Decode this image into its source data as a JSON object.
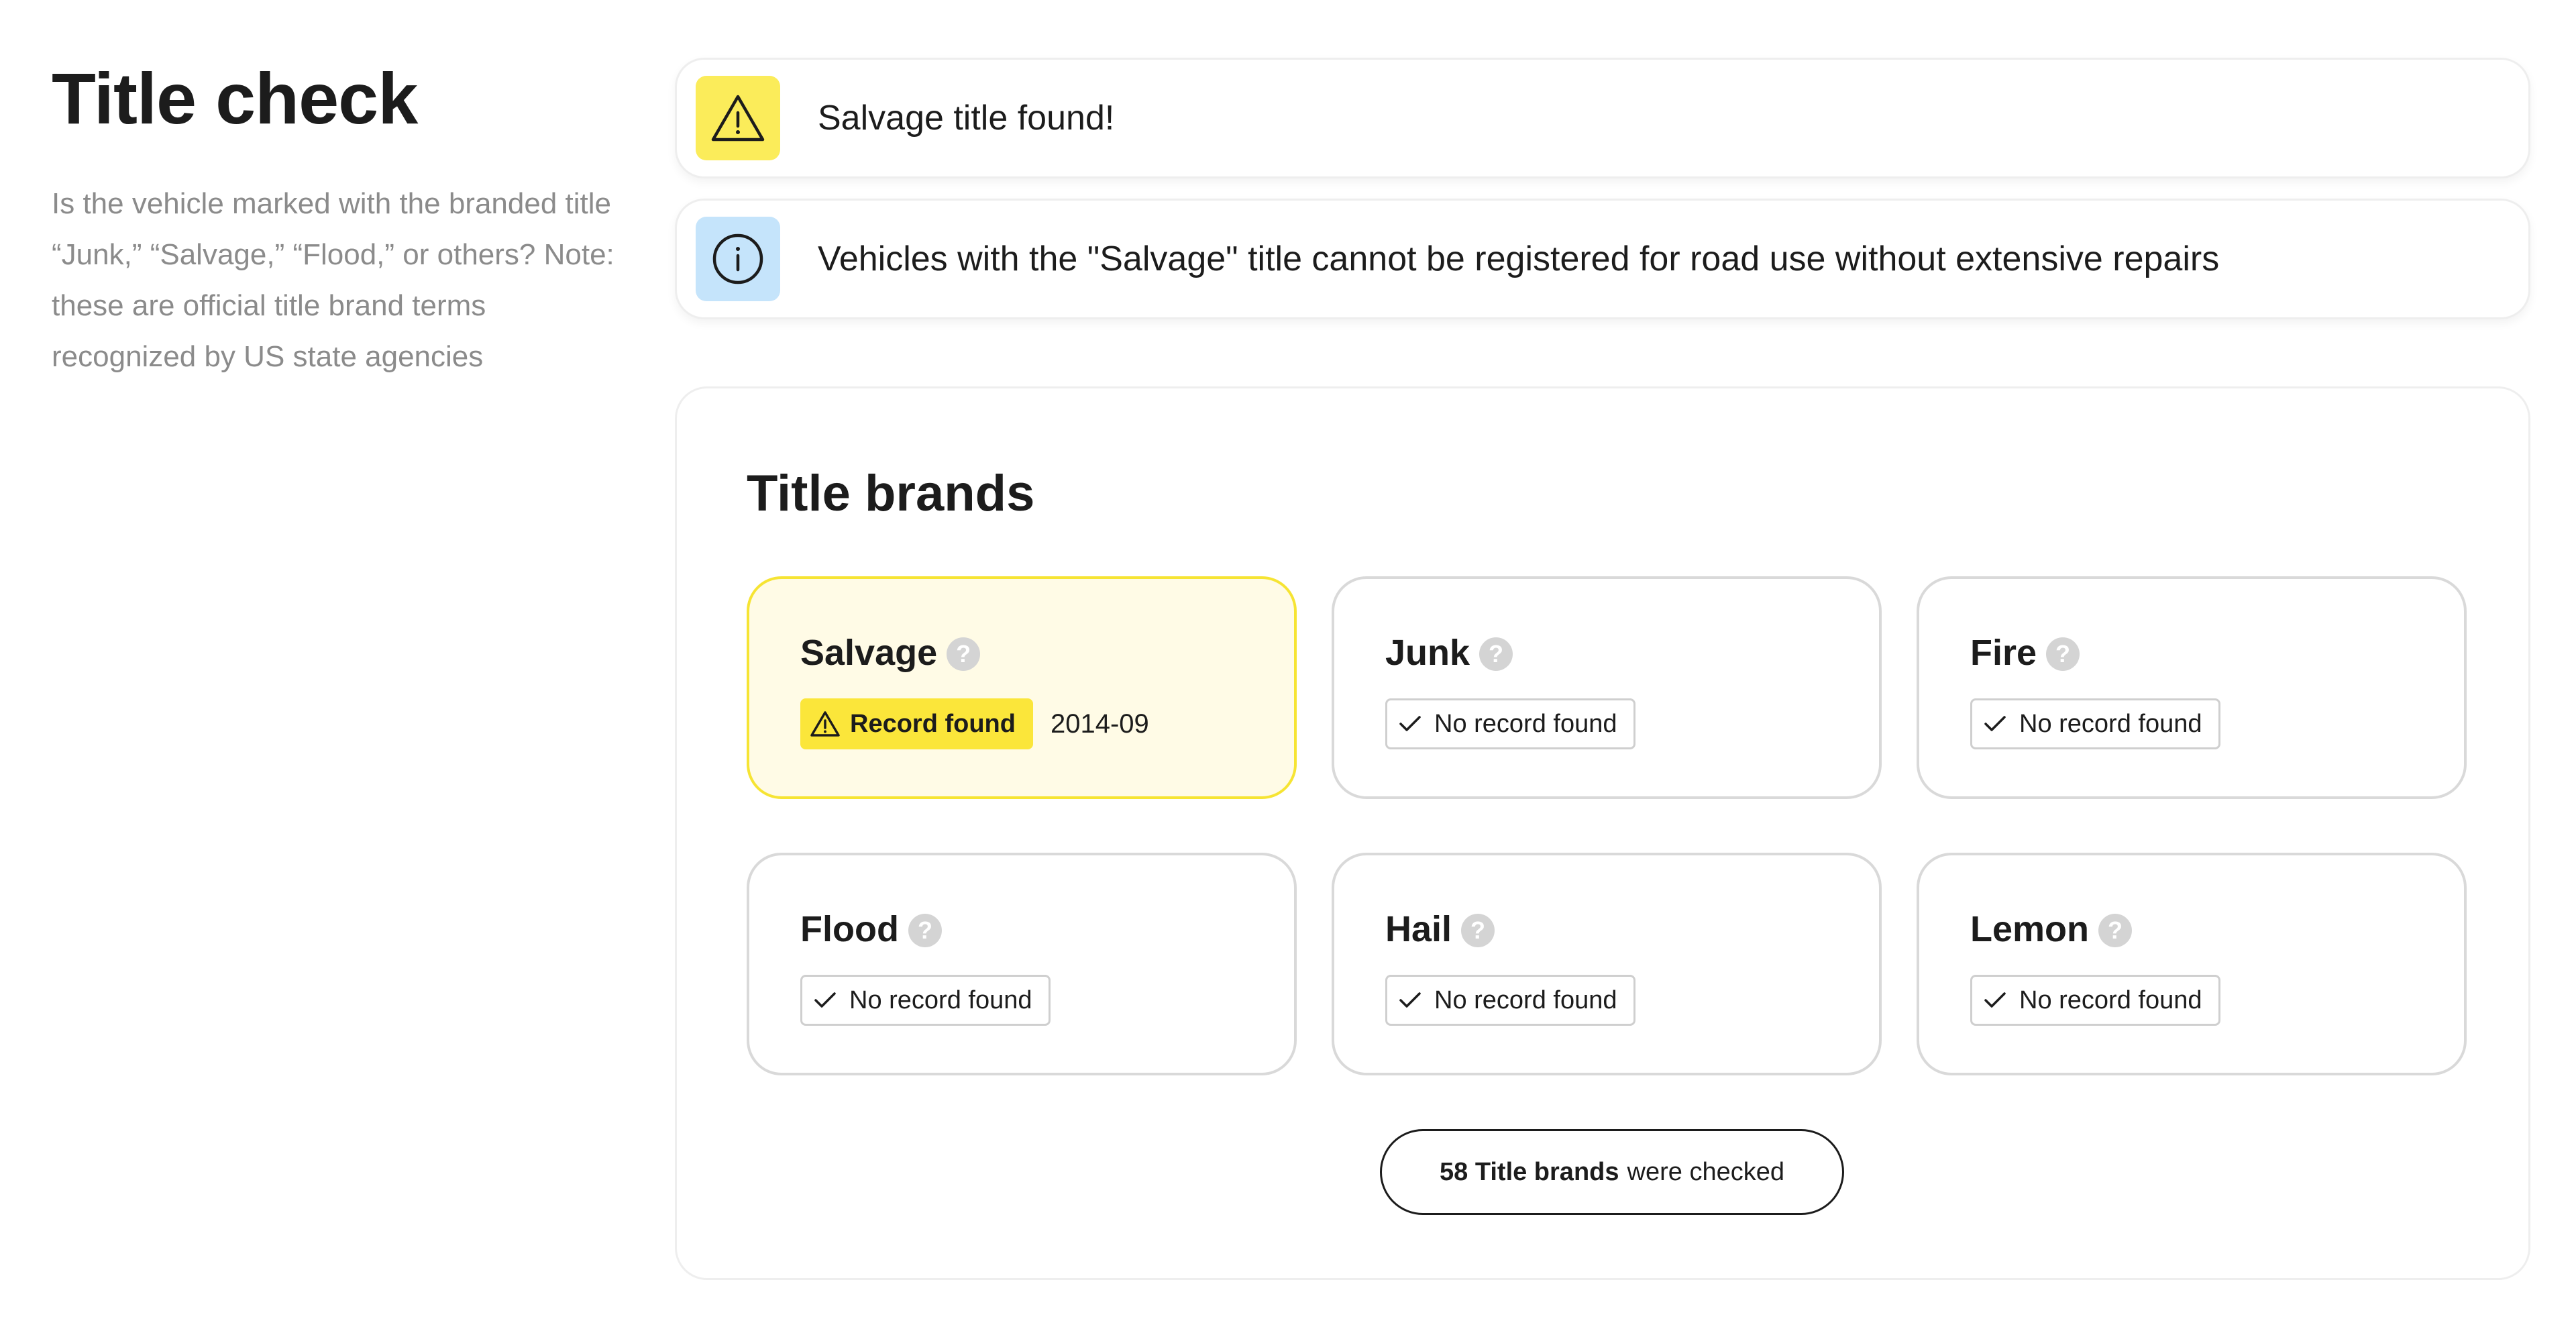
{
  "header": {
    "title": "Title check",
    "description": "Is the vehicle marked with the branded title “Junk,” “Salvage,” “Flood,” or others? Note: these are official title brand terms recognized by US state agencies"
  },
  "alerts": [
    {
      "icon": "warning-triangle-icon",
      "text": "Salvage title found!",
      "color": "#fbec5a"
    },
    {
      "icon": "info-circle-icon",
      "text": "Vehicles with the \"Salvage\" title cannot be registered for road use without extensive repairs",
      "color": "#c5e4fb"
    }
  ],
  "title_brands": {
    "heading": "Title brands",
    "help_symbol": "?",
    "brands": [
      {
        "name": "Salvage",
        "status": "Record found",
        "date": "2014-09",
        "found": true
      },
      {
        "name": "Junk",
        "status": "No record found",
        "found": false
      },
      {
        "name": "Fire",
        "status": "No record found",
        "found": false
      },
      {
        "name": "Flood",
        "status": "No record found",
        "found": false
      },
      {
        "name": "Hail",
        "status": "No record found",
        "found": false
      },
      {
        "name": "Lemon",
        "status": "No record found",
        "found": false
      }
    ],
    "checked_bold": "58 Title brands",
    "checked_rest": "were checked"
  },
  "colors": {
    "found_accent": "#fbe63a",
    "found_card_bg": "#fffbe6",
    "info_accent": "#c5e4fb"
  }
}
